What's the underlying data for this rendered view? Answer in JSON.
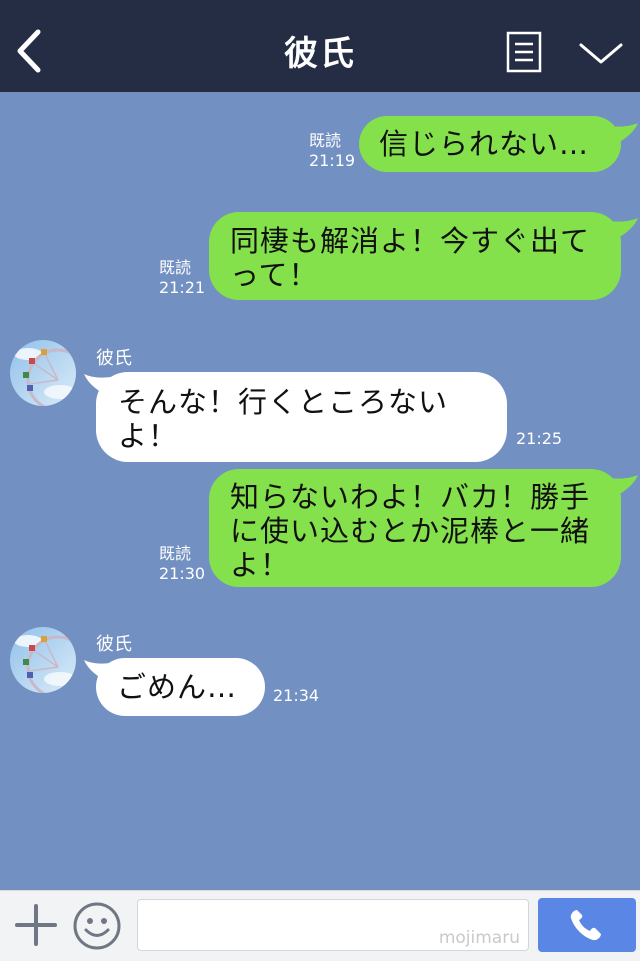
{
  "header": {
    "title": "彼氏"
  },
  "messages": [
    {
      "from": "me",
      "text": "信じられない…",
      "read_label": "既読",
      "time": "21:19"
    },
    {
      "from": "me",
      "text": "同棲も解消よ！今すぐ出てって！",
      "read_label": "既読",
      "time": "21:21"
    },
    {
      "from": "partner",
      "sender": "彼氏",
      "text": "そんな！行くところないよ！",
      "time": "21:25"
    },
    {
      "from": "me",
      "text": "知らないわよ！バカ！勝手に使い込むとか泥棒と一緒よ！",
      "read_label": "既読",
      "time": "21:30"
    },
    {
      "from": "partner",
      "sender": "彼氏",
      "text": "ごめん…",
      "time": "21:34"
    }
  ],
  "input": {
    "value": "",
    "watermark": "mojimaru"
  },
  "colors": {
    "header_bg": "#252d44",
    "chat_bg": "#7290c1",
    "my_bubble": "#84e04b",
    "partner_bubble": "#ffffff",
    "call_button": "#5a87e5"
  },
  "icons": {
    "back": "back-chevron-icon",
    "menu": "menu-list-icon",
    "collapse": "chevron-down-icon",
    "add": "plus-icon",
    "emoji": "smiley-icon",
    "call": "phone-icon"
  }
}
